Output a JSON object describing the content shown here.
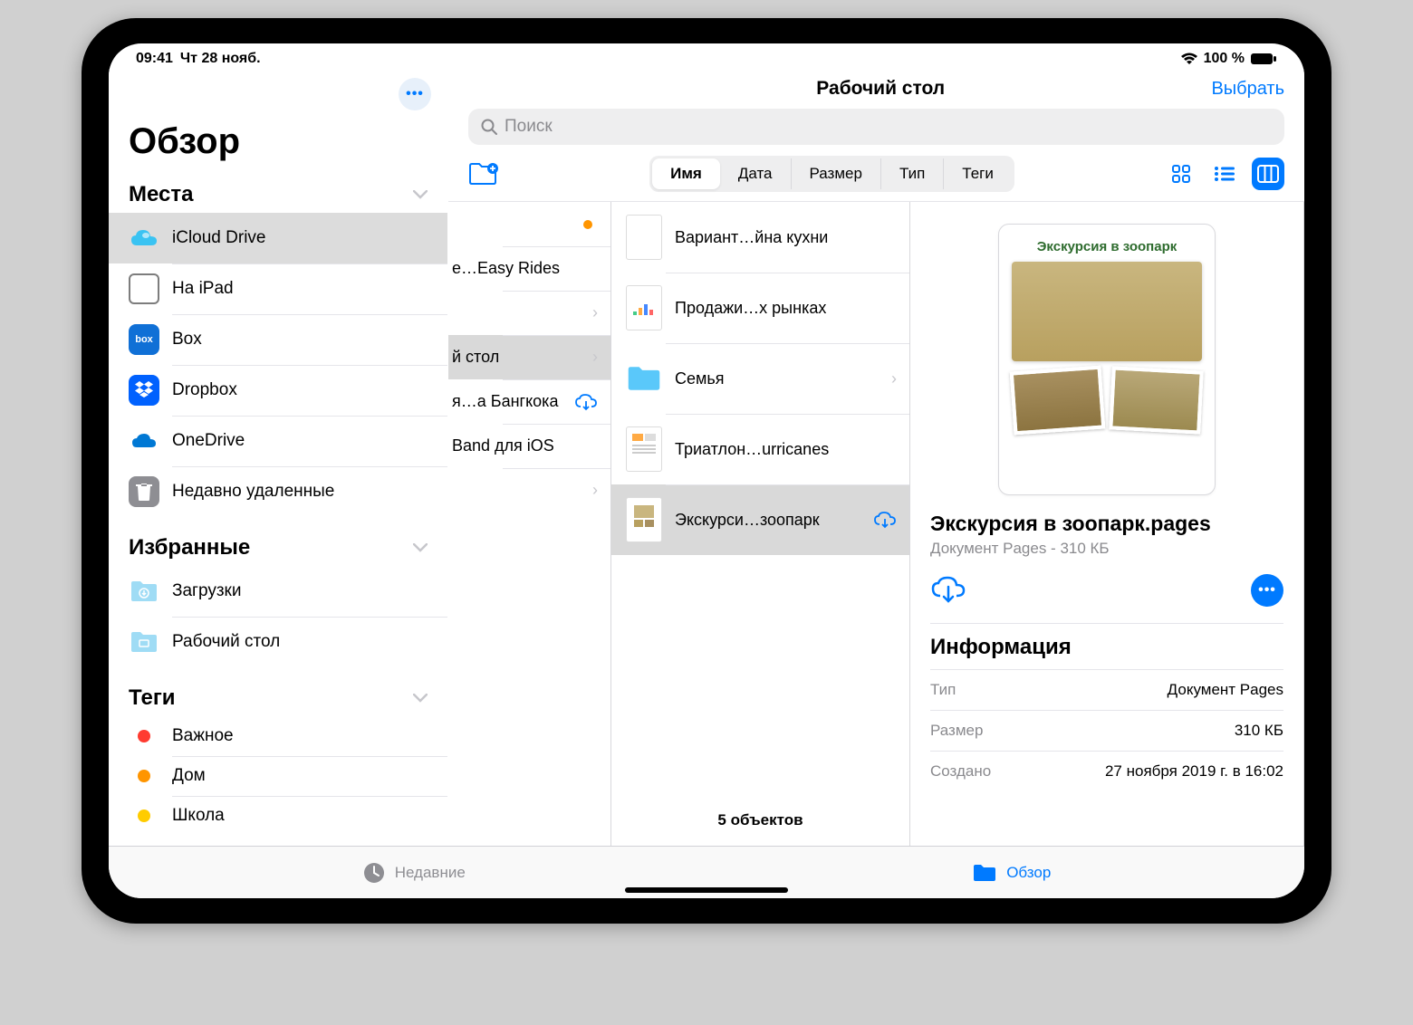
{
  "status": {
    "time": "09:41",
    "date": "Чт 28 нояб.",
    "battery": "100 %"
  },
  "sidebar": {
    "more": "•••",
    "title": "Обзор",
    "sections": {
      "places": {
        "header": "Места",
        "items": [
          {
            "label": "iCloud Drive"
          },
          {
            "label": "На iPad"
          },
          {
            "label": "Box"
          },
          {
            "label": "Dropbox"
          },
          {
            "label": "OneDrive"
          },
          {
            "label": "Недавно удаленные"
          }
        ]
      },
      "favorites": {
        "header": "Избранные",
        "items": [
          {
            "label": "Загрузки"
          },
          {
            "label": "Рабочий стол"
          }
        ]
      },
      "tags": {
        "header": "Теги",
        "items": [
          {
            "label": "Важное",
            "color": "#ff3b30"
          },
          {
            "label": "Дом",
            "color": "#ff9500"
          },
          {
            "label": "Школа",
            "color": "#ffcc00"
          }
        ]
      }
    }
  },
  "header": {
    "location": "Рабочий стол",
    "select": "Выбрать",
    "search_placeholder": "Поиск",
    "sort": [
      "Имя",
      "Дата",
      "Размер",
      "Тип",
      "Теги"
    ]
  },
  "col1": [
    {
      "label": "",
      "dot": true
    },
    {
      "label": "e…Easy Rides"
    },
    {
      "label": "",
      "chev": true
    },
    {
      "label": "й стол",
      "sel": true,
      "chev": true
    },
    {
      "label": "я…а Бангкока",
      "cloud": true
    },
    {
      "label": "Band для iOS"
    },
    {
      "label": "",
      "chev": true
    }
  ],
  "col2": {
    "items": [
      {
        "label": "Вариант…йна кухни"
      },
      {
        "label": "Продажи…х рынках"
      },
      {
        "label": "Семья",
        "folder": true,
        "chev": true
      },
      {
        "label": "Триатлон…urricanes"
      },
      {
        "label": "Экскурси…зоопарк",
        "sel": true,
        "cloud": true
      }
    ],
    "count": "5 объектов"
  },
  "preview": {
    "doc_title": "Экскурсия в зоопарк",
    "filename": "Экскурсия в зоопарк.pages",
    "subtitle": "Документ Pages - 310 КБ",
    "info_header": "Информация",
    "info": [
      {
        "k": "Тип",
        "v": "Документ Pages"
      },
      {
        "k": "Размер",
        "v": "310 КБ"
      },
      {
        "k": "Создано",
        "v": "27 ноября 2019 г. в 16:02"
      }
    ]
  },
  "tabs": {
    "recent": "Недавние",
    "browse": "Обзор"
  }
}
